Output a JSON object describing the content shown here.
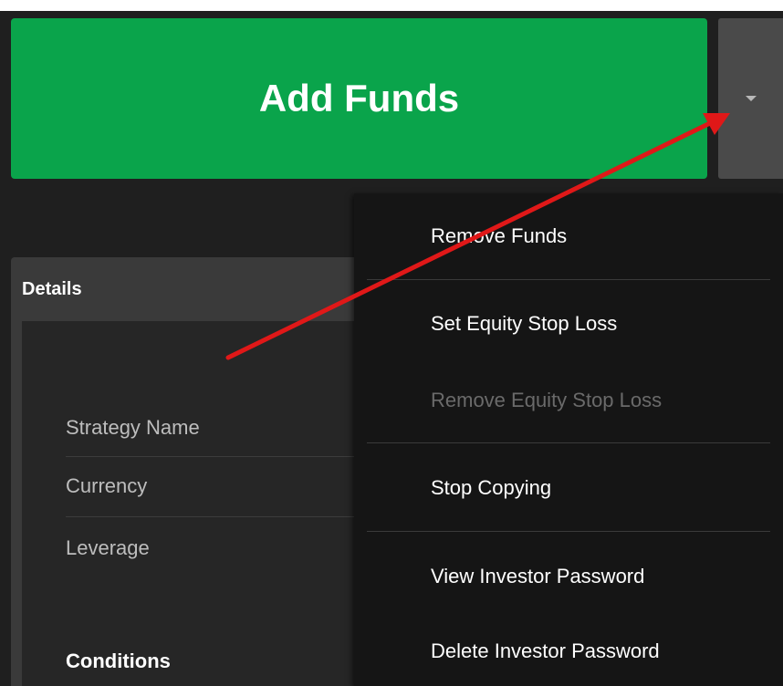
{
  "primary_action": {
    "label": "Add Funds",
    "color": "#0aa44b"
  },
  "dropdown_toggle": {
    "icon": "caret-down-icon"
  },
  "details": {
    "header": "Details",
    "rows": [
      {
        "label": "Strategy Name"
      },
      {
        "label": "Currency"
      },
      {
        "label": "Leverage"
      }
    ],
    "conditions_label": "Conditions"
  },
  "menu": {
    "items": [
      {
        "label": "Remove Funds",
        "enabled": true
      },
      {
        "label": "Set Equity Stop Loss",
        "enabled": true
      },
      {
        "label": "Remove Equity Stop Loss",
        "enabled": false
      },
      {
        "label": "Stop Copying",
        "enabled": true
      },
      {
        "label": "View Investor Password",
        "enabled": true
      },
      {
        "label": "Delete Investor Password",
        "enabled": true
      }
    ]
  },
  "annotation": {
    "type": "red-arrow",
    "color": "#e01818",
    "points_to": "dropdown-toggle"
  }
}
